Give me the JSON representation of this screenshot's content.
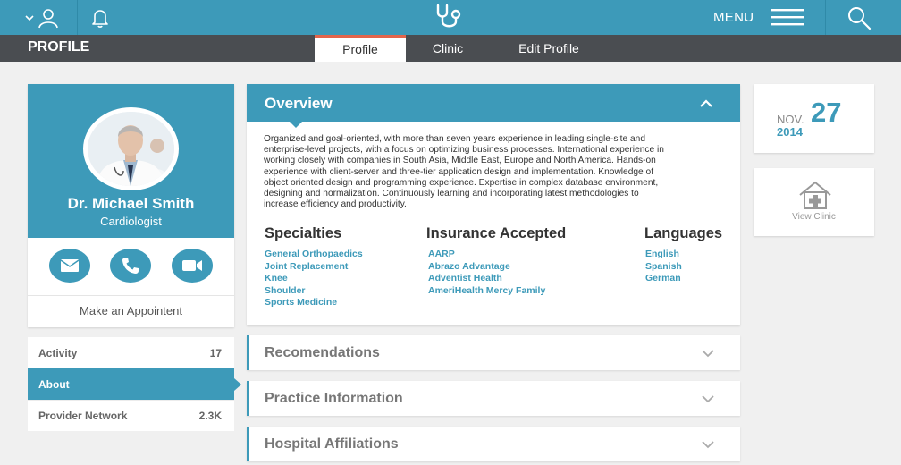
{
  "header": {
    "menu_label": "MENU"
  },
  "subnav": {
    "title": "PROFILE",
    "tabs": [
      {
        "label": "Profile",
        "active": true
      },
      {
        "label": "Clinic",
        "active": false
      },
      {
        "label": "Edit Profile",
        "active": false
      }
    ]
  },
  "profile": {
    "name": "Dr. Michael Smith",
    "role": "Cardiologist",
    "appointment_label": "Make an Appointent"
  },
  "sidebar": {
    "items": [
      {
        "label": "Activity",
        "count": "17"
      },
      {
        "label": "About",
        "count": ""
      },
      {
        "label": "Provider Network",
        "count": "2.3K"
      }
    ]
  },
  "overview": {
    "title": "Overview",
    "lines": [
      "Organized and goal-oriented, with more than seven years experience in leading single-site and",
      "enterprise-level projects, with a focus on optimizing business processes. International experience in",
      "working closely with companies in South Asia, Middle East, Europe and North America. Hands-on",
      "experience with client-server and three-tier application design and implementation. Knowledge of",
      "object oriented design and programming experience. Expertise in complex database environment,",
      "designing and normalization. Continuously learning and incorporating latest methodologies to",
      "increase efficiency and productivity."
    ],
    "columns": [
      {
        "title": "Specialties",
        "items": [
          "General Orthopaedics",
          "Joint Replacement",
          "Knee",
          "Shoulder",
          "Sports Medicine"
        ]
      },
      {
        "title": "Insurance Accepted",
        "items": [
          "AARP",
          "Abrazo Advantage",
          "Adventist Health",
          "AmeriHealth Mercy Family"
        ]
      },
      {
        "title": "Languages",
        "items": [
          "English",
          "Spanish",
          "German"
        ]
      }
    ]
  },
  "sections": [
    {
      "title": "Recomendations"
    },
    {
      "title": "Practice Information"
    },
    {
      "title": "Hospital Affiliations"
    }
  ],
  "date": {
    "month": "NOV.",
    "day": "27",
    "year": "2014"
  },
  "clinic": {
    "label": "View Clinic"
  },
  "colors": {
    "primary": "#3d9ab9",
    "dark_bar": "#4a4d51",
    "tab_accent": "#e3654b",
    "background": "#f0f0f0"
  },
  "icons": [
    "user-icon",
    "chevron-down-icon",
    "bell-icon",
    "stethoscope-icon",
    "hamburger-icon",
    "search-icon",
    "mail-icon",
    "phone-icon",
    "video-icon",
    "chevron-up-icon",
    "clinic-icon"
  ]
}
